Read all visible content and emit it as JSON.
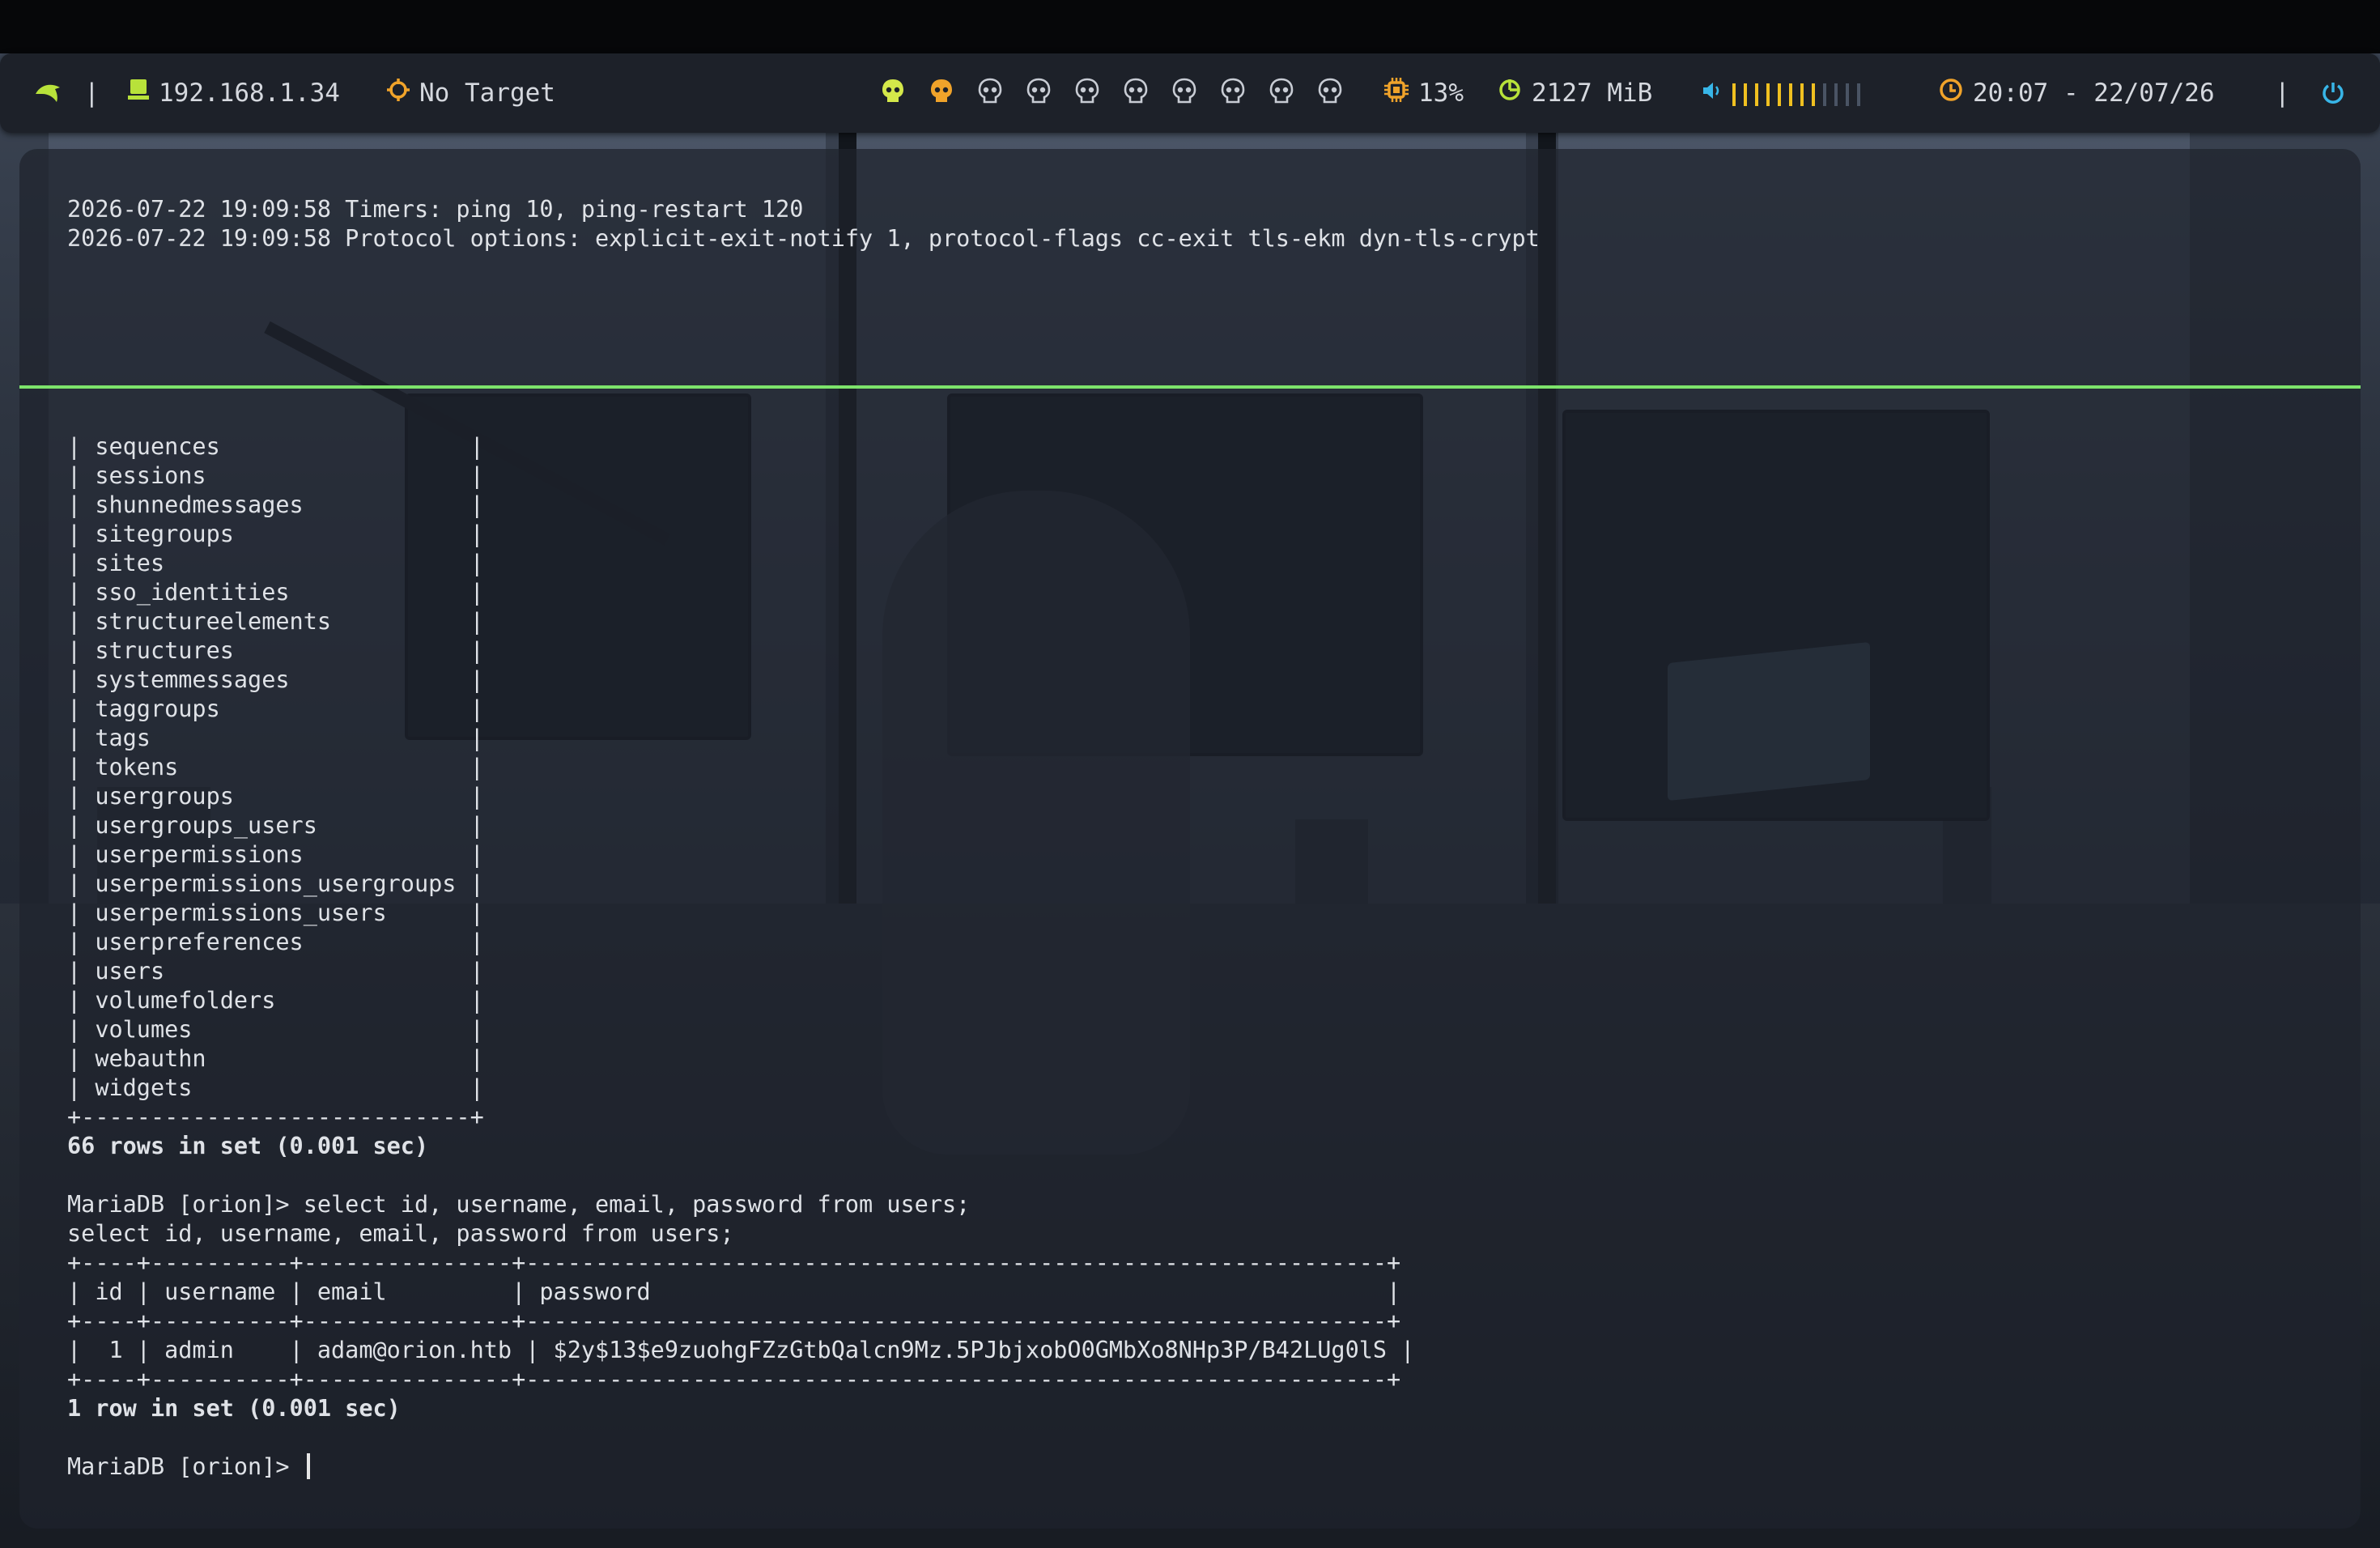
{
  "topbar": {
    "ip": "192.168.1.34",
    "target": "No Target",
    "cpu": "13%",
    "memory": "2127 MiB",
    "clock": "20:07 - 22/07/26",
    "volume_level": 0.7,
    "workspaces": [
      {
        "state": "active",
        "color": "#d4e84a"
      },
      {
        "state": "occupied",
        "color": "#f0a32a"
      },
      {
        "state": "empty",
        "color": "#c8ccd4"
      },
      {
        "state": "empty",
        "color": "#c8ccd4"
      },
      {
        "state": "empty",
        "color": "#c8ccd4"
      },
      {
        "state": "empty",
        "color": "#c8ccd4"
      },
      {
        "state": "empty",
        "color": "#c8ccd4"
      },
      {
        "state": "empty",
        "color": "#c8ccd4"
      },
      {
        "state": "empty",
        "color": "#c8ccd4"
      },
      {
        "state": "empty",
        "color": "#c8ccd4"
      }
    ]
  },
  "colors": {
    "accent_green": "#7de36b",
    "ip_green": "#b8e23a",
    "amber": "#f0a32a",
    "cyan": "#38b6e8"
  },
  "vpn_log": [
    "2026-07-22 19:09:58 Timers: ping 10, ping-restart 120",
    "2026-07-22 19:09:58 Protocol options: explicit-exit-notify 1, protocol-flags cc-exit tls-ekm dyn-tls-crypt"
  ],
  "terminal": {
    "lines": [
      "| sequences                  |",
      "| sessions                   |",
      "| shunnedmessages            |",
      "| sitegroups                 |",
      "| sites                      |",
      "| sso_identities             |",
      "| structureelements          |",
      "| structures                 |",
      "| systemmessages             |",
      "| taggroups                  |",
      "| tags                       |",
      "| tokens                     |",
      "| usergroups                 |",
      "| usergroups_users           |",
      "| userpermissions            |",
      "| userpermissions_usergroups |",
      "| userpermissions_users      |",
      "| userpreferences            |",
      "| users                      |",
      "| volumefolders              |",
      "| volumes                    |",
      "| webauthn                   |",
      "| widgets                    |",
      "+----------------------------+",
      "66 rows in set (0.001 sec)",
      "",
      "MariaDB [orion]> select id, username, email, password from users;",
      "select id, username, email, password from users;",
      "+----+----------+---------------+--------------------------------------------------------------+",
      "| id | username | email         | password                                                     |",
      "+----+----------+---------------+--------------------------------------------------------------+",
      "|  1 | admin    | adam@orion.htb | $2y$13$e9zuohgFZzGtbQalcn9Mz.5PJbjxobO0GMbXo8NHp3P/B42LUg0lS |",
      "+----+----------+---------------+--------------------------------------------------------------+",
      "1 row in set (0.001 sec)",
      "",
      "MariaDB [orion]> "
    ],
    "bold_lines": [
      24,
      33
    ]
  }
}
